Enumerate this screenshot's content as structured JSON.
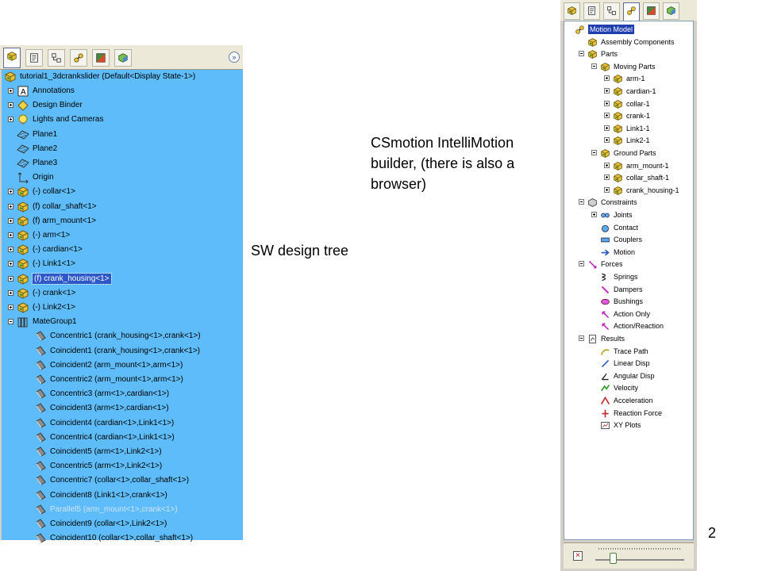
{
  "slide": {
    "caption_sw": "SW design tree",
    "caption_mm_lines": [
      "CSmotion IntelliMotion",
      "builder, (there is also a",
      "browser)"
    ],
    "page_number": "2"
  },
  "sw_tree": {
    "toolbar_icons": [
      "feature-manager-icon",
      "property-manager-icon",
      "configuration-manager-icon",
      "motion-icon",
      "appearance-icon",
      "display-icon"
    ],
    "expand_icon": "»",
    "root": "tutorial1_3dcrankslider  (Default<Display State-1>)",
    "items": [
      {
        "label": "Annotations",
        "icon": "annotations-icon",
        "expander": "plus",
        "indent": 1
      },
      {
        "label": "Design Binder",
        "icon": "design-binder-icon",
        "expander": "plus",
        "indent": 1
      },
      {
        "label": "Lights and Cameras",
        "icon": "lights-icon",
        "expander": "plus",
        "indent": 1
      },
      {
        "label": "Plane1",
        "icon": "plane-icon",
        "expander": "none",
        "indent": 1
      },
      {
        "label": "Plane2",
        "icon": "plane-icon",
        "expander": "none",
        "indent": 1
      },
      {
        "label": "Plane3",
        "icon": "plane-icon",
        "expander": "none",
        "indent": 1
      },
      {
        "label": "Origin",
        "icon": "origin-icon",
        "expander": "none",
        "indent": 1
      },
      {
        "label": "(-) collar<1>",
        "icon": "part-icon",
        "expander": "plus",
        "indent": 1
      },
      {
        "label": "(f) collar_shaft<1>",
        "icon": "part-icon",
        "expander": "plus",
        "indent": 1
      },
      {
        "label": "(f) arm_mount<1>",
        "icon": "part-icon",
        "expander": "plus",
        "indent": 1
      },
      {
        "label": "(-) arm<1>",
        "icon": "part-icon",
        "expander": "plus",
        "indent": 1
      },
      {
        "label": "(-) cardian<1>",
        "icon": "part-icon",
        "expander": "plus",
        "indent": 1
      },
      {
        "label": "(-) Link1<1>",
        "icon": "part-icon",
        "expander": "plus",
        "indent": 1
      },
      {
        "label": "(f) crank_housing<1>",
        "icon": "part-icon",
        "expander": "plus",
        "indent": 1,
        "selected": true
      },
      {
        "label": "(-) crank<1>",
        "icon": "part-icon",
        "expander": "plus",
        "indent": 1
      },
      {
        "label": "(-) Link2<1>",
        "icon": "part-icon",
        "expander": "plus",
        "indent": 1
      },
      {
        "label": "MateGroup1",
        "icon": "mate-group-icon",
        "expander": "minus",
        "indent": 1
      },
      {
        "label": "Concentric1 (crank_housing<1>,crank<1>)",
        "icon": "mate-icon",
        "expander": "none",
        "indent": 2
      },
      {
        "label": "Coincident1 (crank_housing<1>,crank<1>)",
        "icon": "mate-icon",
        "expander": "none",
        "indent": 2
      },
      {
        "label": "Coincident2 (arm_mount<1>,arm<1>)",
        "icon": "mate-icon",
        "expander": "none",
        "indent": 2
      },
      {
        "label": "Concentric2 (arm_mount<1>,arm<1>)",
        "icon": "mate-icon",
        "expander": "none",
        "indent": 2
      },
      {
        "label": "Concentric3 (arm<1>,cardian<1>)",
        "icon": "mate-icon",
        "expander": "none",
        "indent": 2
      },
      {
        "label": "Coincident3 (arm<1>,cardian<1>)",
        "icon": "mate-icon",
        "expander": "none",
        "indent": 2
      },
      {
        "label": "Coincident4 (cardian<1>,Link1<1>)",
        "icon": "mate-icon",
        "expander": "none",
        "indent": 2
      },
      {
        "label": "Concentric4 (cardian<1>,Link1<1>)",
        "icon": "mate-icon",
        "expander": "none",
        "indent": 2
      },
      {
        "label": "Coincident5 (arm<1>,Link2<1>)",
        "icon": "mate-icon",
        "expander": "none",
        "indent": 2
      },
      {
        "label": "Concentric5 (arm<1>,Link2<1>)",
        "icon": "mate-icon",
        "expander": "none",
        "indent": 2
      },
      {
        "label": "Concentric7 (collar<1>,collar_shaft<1>)",
        "icon": "mate-icon",
        "expander": "none",
        "indent": 2
      },
      {
        "label": "Coincident8 (Link1<1>,crank<1>)",
        "icon": "mate-icon",
        "expander": "none",
        "indent": 2
      },
      {
        "label": "Parallel5 (arm_mount<1>,crank<1>)",
        "icon": "mate-icon",
        "expander": "none",
        "indent": 2,
        "dim": true
      },
      {
        "label": "Coincident9 (collar<1>,Link2<1>)",
        "icon": "mate-icon",
        "expander": "none",
        "indent": 2
      },
      {
        "label": "Coincident10 (collar<1>,collar_shaft<1>)",
        "icon": "mate-icon",
        "expander": "none",
        "indent": 2
      }
    ]
  },
  "mm_tree": {
    "toolbar_icons": [
      "feature-manager-icon",
      "property-manager-icon",
      "configuration-manager-icon",
      "motion-icon",
      "appearance-icon",
      "display-icon"
    ],
    "close_glyph": "×",
    "items": [
      {
        "label": "Motion Model",
        "icon": "motion-model-icon",
        "indent": 0,
        "expander": "none",
        "selected": true
      },
      {
        "label": "Assembly Components",
        "icon": "assembly-icon",
        "indent": 1,
        "expander": "none"
      },
      {
        "label": "Parts",
        "icon": "part-icon",
        "indent": 1,
        "expander": "minus"
      },
      {
        "label": "Moving Parts",
        "icon": "part-icon",
        "indent": 2,
        "expander": "minus"
      },
      {
        "label": "arm-1",
        "icon": "part-icon",
        "indent": 3,
        "expander": "plus"
      },
      {
        "label": "cardian-1",
        "icon": "part-icon",
        "indent": 3,
        "expander": "plus"
      },
      {
        "label": "collar-1",
        "icon": "part-icon",
        "indent": 3,
        "expander": "plus"
      },
      {
        "label": "crank-1",
        "icon": "part-icon",
        "indent": 3,
        "expander": "plus"
      },
      {
        "label": "Link1-1",
        "icon": "part-icon",
        "indent": 3,
        "expander": "plus"
      },
      {
        "label": "Link2-1",
        "icon": "part-icon",
        "indent": 3,
        "expander": "plus"
      },
      {
        "label": "Ground Parts",
        "icon": "part-icon",
        "indent": 2,
        "expander": "minus"
      },
      {
        "label": "arm_mount-1",
        "icon": "part-icon",
        "indent": 3,
        "expander": "plus"
      },
      {
        "label": "collar_shaft-1",
        "icon": "part-icon",
        "indent": 3,
        "expander": "plus"
      },
      {
        "label": "crank_housing-1",
        "icon": "part-icon",
        "indent": 3,
        "expander": "plus"
      },
      {
        "label": "Constraints",
        "icon": "constraints-icon",
        "indent": 1,
        "expander": "minus"
      },
      {
        "label": "Joints",
        "icon": "joints-icon",
        "indent": 2,
        "expander": "plus"
      },
      {
        "label": "Contact",
        "icon": "contact-icon",
        "indent": 2,
        "expander": "none"
      },
      {
        "label": "Couplers",
        "icon": "couplers-icon",
        "indent": 2,
        "expander": "none"
      },
      {
        "label": "Motion",
        "icon": "motion-arrow-icon",
        "indent": 2,
        "expander": "none"
      },
      {
        "label": "Forces",
        "icon": "forces-icon",
        "indent": 1,
        "expander": "minus"
      },
      {
        "label": "Springs",
        "icon": "springs-icon",
        "indent": 2,
        "expander": "none"
      },
      {
        "label": "Dampers",
        "icon": "dampers-icon",
        "indent": 2,
        "expander": "none"
      },
      {
        "label": "Bushings",
        "icon": "bushings-icon",
        "indent": 2,
        "expander": "none"
      },
      {
        "label": "Action Only",
        "icon": "action-only-icon",
        "indent": 2,
        "expander": "none"
      },
      {
        "label": "Action/Reaction",
        "icon": "action-reaction-icon",
        "indent": 2,
        "expander": "none"
      },
      {
        "label": "Results",
        "icon": "results-icon",
        "indent": 1,
        "expander": "minus"
      },
      {
        "label": "Trace Path",
        "icon": "trace-path-icon",
        "indent": 2,
        "expander": "none"
      },
      {
        "label": "Linear Disp",
        "icon": "linear-disp-icon",
        "indent": 2,
        "expander": "none"
      },
      {
        "label": "Angular Disp",
        "icon": "angular-disp-icon",
        "indent": 2,
        "expander": "none"
      },
      {
        "label": "Velocity",
        "icon": "velocity-icon",
        "indent": 2,
        "expander": "none"
      },
      {
        "label": "Acceleration",
        "icon": "acceleration-icon",
        "indent": 2,
        "expander": "none"
      },
      {
        "label": "Reaction Force",
        "icon": "reaction-force-icon",
        "indent": 2,
        "expander": "none"
      },
      {
        "label": "XY Plots",
        "icon": "xy-plots-icon",
        "indent": 2,
        "expander": "none"
      }
    ]
  }
}
